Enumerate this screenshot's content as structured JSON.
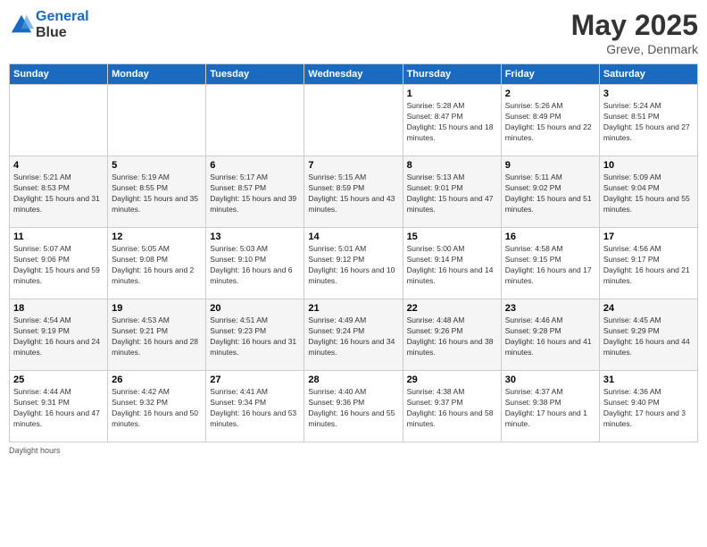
{
  "header": {
    "logo_line1": "General",
    "logo_line2": "Blue",
    "month": "May 2025",
    "location": "Greve, Denmark"
  },
  "days_of_week": [
    "Sunday",
    "Monday",
    "Tuesday",
    "Wednesday",
    "Thursday",
    "Friday",
    "Saturday"
  ],
  "weeks": [
    [
      {
        "day": "",
        "sunrise": "",
        "sunset": "",
        "daylight": ""
      },
      {
        "day": "",
        "sunrise": "",
        "sunset": "",
        "daylight": ""
      },
      {
        "day": "",
        "sunrise": "",
        "sunset": "",
        "daylight": ""
      },
      {
        "day": "",
        "sunrise": "",
        "sunset": "",
        "daylight": ""
      },
      {
        "day": "1",
        "sunrise": "Sunrise: 5:28 AM",
        "sunset": "Sunset: 8:47 PM",
        "daylight": "Daylight: 15 hours and 18 minutes."
      },
      {
        "day": "2",
        "sunrise": "Sunrise: 5:26 AM",
        "sunset": "Sunset: 8:49 PM",
        "daylight": "Daylight: 15 hours and 22 minutes."
      },
      {
        "day": "3",
        "sunrise": "Sunrise: 5:24 AM",
        "sunset": "Sunset: 8:51 PM",
        "daylight": "Daylight: 15 hours and 27 minutes."
      }
    ],
    [
      {
        "day": "4",
        "sunrise": "Sunrise: 5:21 AM",
        "sunset": "Sunset: 8:53 PM",
        "daylight": "Daylight: 15 hours and 31 minutes."
      },
      {
        "day": "5",
        "sunrise": "Sunrise: 5:19 AM",
        "sunset": "Sunset: 8:55 PM",
        "daylight": "Daylight: 15 hours and 35 minutes."
      },
      {
        "day": "6",
        "sunrise": "Sunrise: 5:17 AM",
        "sunset": "Sunset: 8:57 PM",
        "daylight": "Daylight: 15 hours and 39 minutes."
      },
      {
        "day": "7",
        "sunrise": "Sunrise: 5:15 AM",
        "sunset": "Sunset: 8:59 PM",
        "daylight": "Daylight: 15 hours and 43 minutes."
      },
      {
        "day": "8",
        "sunrise": "Sunrise: 5:13 AM",
        "sunset": "Sunset: 9:01 PM",
        "daylight": "Daylight: 15 hours and 47 minutes."
      },
      {
        "day": "9",
        "sunrise": "Sunrise: 5:11 AM",
        "sunset": "Sunset: 9:02 PM",
        "daylight": "Daylight: 15 hours and 51 minutes."
      },
      {
        "day": "10",
        "sunrise": "Sunrise: 5:09 AM",
        "sunset": "Sunset: 9:04 PM",
        "daylight": "Daylight: 15 hours and 55 minutes."
      }
    ],
    [
      {
        "day": "11",
        "sunrise": "Sunrise: 5:07 AM",
        "sunset": "Sunset: 9:06 PM",
        "daylight": "Daylight: 15 hours and 59 minutes."
      },
      {
        "day": "12",
        "sunrise": "Sunrise: 5:05 AM",
        "sunset": "Sunset: 9:08 PM",
        "daylight": "Daylight: 16 hours and 2 minutes."
      },
      {
        "day": "13",
        "sunrise": "Sunrise: 5:03 AM",
        "sunset": "Sunset: 9:10 PM",
        "daylight": "Daylight: 16 hours and 6 minutes."
      },
      {
        "day": "14",
        "sunrise": "Sunrise: 5:01 AM",
        "sunset": "Sunset: 9:12 PM",
        "daylight": "Daylight: 16 hours and 10 minutes."
      },
      {
        "day": "15",
        "sunrise": "Sunrise: 5:00 AM",
        "sunset": "Sunset: 9:14 PM",
        "daylight": "Daylight: 16 hours and 14 minutes."
      },
      {
        "day": "16",
        "sunrise": "Sunrise: 4:58 AM",
        "sunset": "Sunset: 9:15 PM",
        "daylight": "Daylight: 16 hours and 17 minutes."
      },
      {
        "day": "17",
        "sunrise": "Sunrise: 4:56 AM",
        "sunset": "Sunset: 9:17 PM",
        "daylight": "Daylight: 16 hours and 21 minutes."
      }
    ],
    [
      {
        "day": "18",
        "sunrise": "Sunrise: 4:54 AM",
        "sunset": "Sunset: 9:19 PM",
        "daylight": "Daylight: 16 hours and 24 minutes."
      },
      {
        "day": "19",
        "sunrise": "Sunrise: 4:53 AM",
        "sunset": "Sunset: 9:21 PM",
        "daylight": "Daylight: 16 hours and 28 minutes."
      },
      {
        "day": "20",
        "sunrise": "Sunrise: 4:51 AM",
        "sunset": "Sunset: 9:23 PM",
        "daylight": "Daylight: 16 hours and 31 minutes."
      },
      {
        "day": "21",
        "sunrise": "Sunrise: 4:49 AM",
        "sunset": "Sunset: 9:24 PM",
        "daylight": "Daylight: 16 hours and 34 minutes."
      },
      {
        "day": "22",
        "sunrise": "Sunrise: 4:48 AM",
        "sunset": "Sunset: 9:26 PM",
        "daylight": "Daylight: 16 hours and 38 minutes."
      },
      {
        "day": "23",
        "sunrise": "Sunrise: 4:46 AM",
        "sunset": "Sunset: 9:28 PM",
        "daylight": "Daylight: 16 hours and 41 minutes."
      },
      {
        "day": "24",
        "sunrise": "Sunrise: 4:45 AM",
        "sunset": "Sunset: 9:29 PM",
        "daylight": "Daylight: 16 hours and 44 minutes."
      }
    ],
    [
      {
        "day": "25",
        "sunrise": "Sunrise: 4:44 AM",
        "sunset": "Sunset: 9:31 PM",
        "daylight": "Daylight: 16 hours and 47 minutes."
      },
      {
        "day": "26",
        "sunrise": "Sunrise: 4:42 AM",
        "sunset": "Sunset: 9:32 PM",
        "daylight": "Daylight: 16 hours and 50 minutes."
      },
      {
        "day": "27",
        "sunrise": "Sunrise: 4:41 AM",
        "sunset": "Sunset: 9:34 PM",
        "daylight": "Daylight: 16 hours and 53 minutes."
      },
      {
        "day": "28",
        "sunrise": "Sunrise: 4:40 AM",
        "sunset": "Sunset: 9:36 PM",
        "daylight": "Daylight: 16 hours and 55 minutes."
      },
      {
        "day": "29",
        "sunrise": "Sunrise: 4:38 AM",
        "sunset": "Sunset: 9:37 PM",
        "daylight": "Daylight: 16 hours and 58 minutes."
      },
      {
        "day": "30",
        "sunrise": "Sunrise: 4:37 AM",
        "sunset": "Sunset: 9:38 PM",
        "daylight": "Daylight: 17 hours and 1 minute."
      },
      {
        "day": "31",
        "sunrise": "Sunrise: 4:36 AM",
        "sunset": "Sunset: 9:40 PM",
        "daylight": "Daylight: 17 hours and 3 minutes."
      }
    ]
  ],
  "footer": {
    "note": "Daylight hours"
  }
}
